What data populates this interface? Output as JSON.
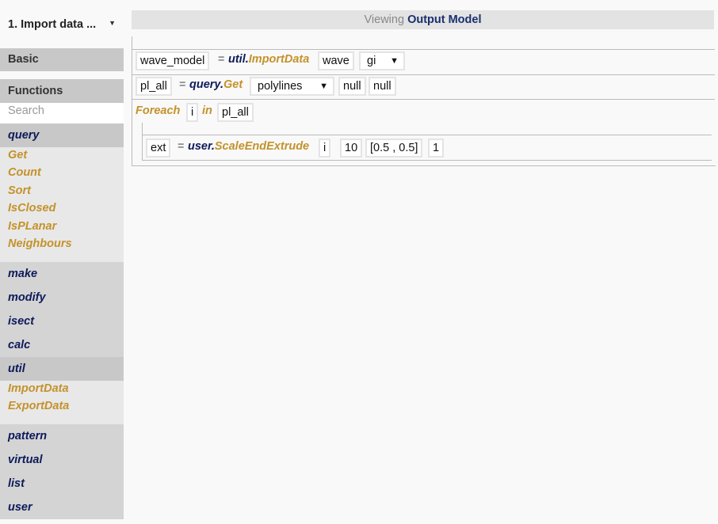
{
  "flow": {
    "selected": "1. Import data ..."
  },
  "sidebar": {
    "basic_label": "Basic",
    "functions_label": "Functions",
    "search_placeholder": "Search",
    "query": {
      "label": "query",
      "functions": [
        "Get",
        "Count",
        "Sort",
        "IsClosed",
        "IsPLanar",
        "Neighbours"
      ]
    },
    "modules_a": [
      "make",
      "modify",
      "isect",
      "calc"
    ],
    "util": {
      "label": "util",
      "functions": [
        "ImportData",
        "ExportData"
      ]
    },
    "modules_b": [
      "pattern",
      "virtual",
      "list",
      "user"
    ]
  },
  "viewbar": {
    "prefix": "Viewing",
    "target": "Output Model"
  },
  "procedure": {
    "line1": {
      "var": "wave_model",
      "eq": "=",
      "module": "util.",
      "function": "ImportData",
      "arg1": "wave",
      "arg2": "gi"
    },
    "line2": {
      "var": "pl_all",
      "eq": "=",
      "module": "query.",
      "function": "Get",
      "arg1": "polylines",
      "arg2": "null",
      "arg3": "null"
    },
    "foreach": {
      "keyword": "Foreach",
      "item": "i",
      "in_keyword": "in",
      "list": "pl_all"
    },
    "line3": {
      "var": "ext",
      "eq": "=",
      "module": "user.",
      "function": "ScaleEndExtrude",
      "arg1": "i",
      "arg2": "10",
      "arg3": "[0.5 , 0.5]",
      "arg4": "1"
    }
  },
  "colors": {
    "module": "#0d1a5a",
    "function": "#c4922a",
    "header_bg": "#c8c8c8",
    "list_bg": "#e8e8e8"
  },
  "icons": {
    "dropdown": "caret-down-icon"
  }
}
